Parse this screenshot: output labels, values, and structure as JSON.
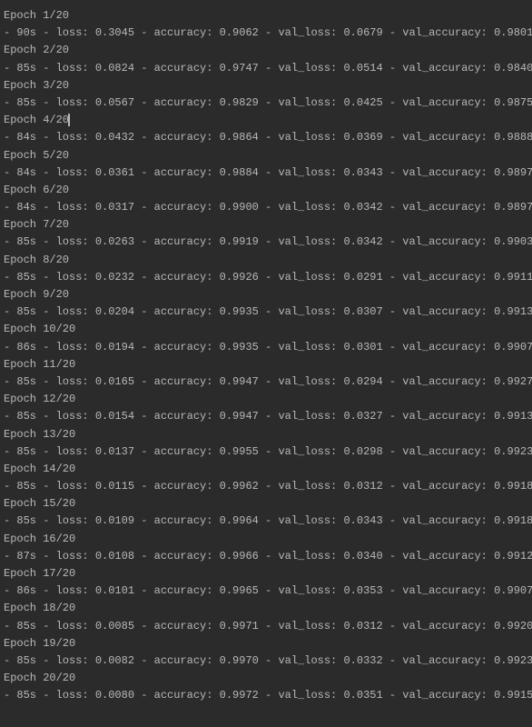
{
  "epochs": [
    {
      "num": 1,
      "total": 20,
      "time": "90s",
      "loss": "0.3045",
      "accuracy": "0.9062",
      "val_loss": "0.0679",
      "val_accuracy": "0.9801",
      "cursor": false
    },
    {
      "num": 2,
      "total": 20,
      "time": "85s",
      "loss": "0.0824",
      "accuracy": "0.9747",
      "val_loss": "0.0514",
      "val_accuracy": "0.9840",
      "cursor": false
    },
    {
      "num": 3,
      "total": 20,
      "time": "85s",
      "loss": "0.0567",
      "accuracy": "0.9829",
      "val_loss": "0.0425",
      "val_accuracy": "0.9875",
      "cursor": false
    },
    {
      "num": 4,
      "total": 20,
      "time": "84s",
      "loss": "0.0432",
      "accuracy": "0.9864",
      "val_loss": "0.0369",
      "val_accuracy": "0.9888",
      "cursor": true
    },
    {
      "num": 5,
      "total": 20,
      "time": "84s",
      "loss": "0.0361",
      "accuracy": "0.9884",
      "val_loss": "0.0343",
      "val_accuracy": "0.9897",
      "cursor": false
    },
    {
      "num": 6,
      "total": 20,
      "time": "84s",
      "loss": "0.0317",
      "accuracy": "0.9900",
      "val_loss": "0.0342",
      "val_accuracy": "0.9897",
      "cursor": false
    },
    {
      "num": 7,
      "total": 20,
      "time": "85s",
      "loss": "0.0263",
      "accuracy": "0.9919",
      "val_loss": "0.0342",
      "val_accuracy": "0.9903",
      "cursor": false
    },
    {
      "num": 8,
      "total": 20,
      "time": "85s",
      "loss": "0.0232",
      "accuracy": "0.9926",
      "val_loss": "0.0291",
      "val_accuracy": "0.9911",
      "cursor": false
    },
    {
      "num": 9,
      "total": 20,
      "time": "85s",
      "loss": "0.0204",
      "accuracy": "0.9935",
      "val_loss": "0.0307",
      "val_accuracy": "0.9913",
      "cursor": false
    },
    {
      "num": 10,
      "total": 20,
      "time": "86s",
      "loss": "0.0194",
      "accuracy": "0.9935",
      "val_loss": "0.0301",
      "val_accuracy": "0.9907",
      "cursor": false
    },
    {
      "num": 11,
      "total": 20,
      "time": "85s",
      "loss": "0.0165",
      "accuracy": "0.9947",
      "val_loss": "0.0294",
      "val_accuracy": "0.9927",
      "cursor": false
    },
    {
      "num": 12,
      "total": 20,
      "time": "85s",
      "loss": "0.0154",
      "accuracy": "0.9947",
      "val_loss": "0.0327",
      "val_accuracy": "0.9913",
      "cursor": false
    },
    {
      "num": 13,
      "total": 20,
      "time": "85s",
      "loss": "0.0137",
      "accuracy": "0.9955",
      "val_loss": "0.0298",
      "val_accuracy": "0.9923",
      "cursor": false
    },
    {
      "num": 14,
      "total": 20,
      "time": "85s",
      "loss": "0.0115",
      "accuracy": "0.9962",
      "val_loss": "0.0312",
      "val_accuracy": "0.9918",
      "cursor": false
    },
    {
      "num": 15,
      "total": 20,
      "time": "85s",
      "loss": "0.0109",
      "accuracy": "0.9964",
      "val_loss": "0.0343",
      "val_accuracy": "0.9918",
      "cursor": false
    },
    {
      "num": 16,
      "total": 20,
      "time": "87s",
      "loss": "0.0108",
      "accuracy": "0.9966",
      "val_loss": "0.0340",
      "val_accuracy": "0.9912",
      "cursor": false
    },
    {
      "num": 17,
      "total": 20,
      "time": "86s",
      "loss": "0.0101",
      "accuracy": "0.9965",
      "val_loss": "0.0353",
      "val_accuracy": "0.9907",
      "cursor": false
    },
    {
      "num": 18,
      "total": 20,
      "time": "85s",
      "loss": "0.0085",
      "accuracy": "0.9971",
      "val_loss": "0.0312",
      "val_accuracy": "0.9920",
      "cursor": false
    },
    {
      "num": 19,
      "total": 20,
      "time": "85s",
      "loss": "0.0082",
      "accuracy": "0.9970",
      "val_loss": "0.0332",
      "val_accuracy": "0.9923",
      "cursor": false
    },
    {
      "num": 20,
      "total": 20,
      "time": "85s",
      "loss": "0.0080",
      "accuracy": "0.9972",
      "val_loss": "0.0351",
      "val_accuracy": "0.9915",
      "cursor": false
    }
  ]
}
